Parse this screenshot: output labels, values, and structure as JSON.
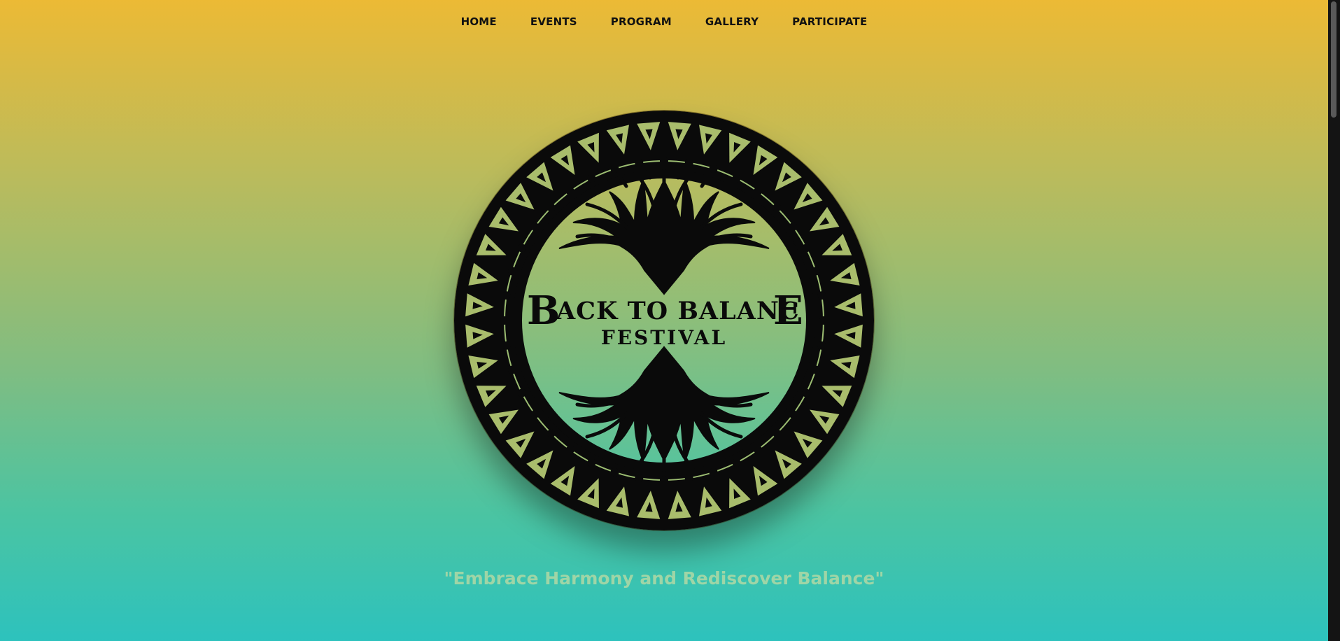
{
  "nav": {
    "items": [
      "HOME",
      "EVENTS",
      "PROGRAM",
      "GALLERY",
      "PARTICIPATE"
    ]
  },
  "logo": {
    "line1_initial_b": "B",
    "line1_middle": "ACK TO BALANC",
    "line1_final_e": "E",
    "line2": "FESTIVAL",
    "icon": "tree-of-life-icon"
  },
  "hero": {
    "tagline": "\"Embrace Harmony and Rediscover Balance\""
  },
  "colors": {
    "gradient_top": "#ecba35",
    "gradient_bottom": "#2dc2bd",
    "tagline": "#9fd5a6",
    "logo_ink": "#0a0a0a"
  }
}
